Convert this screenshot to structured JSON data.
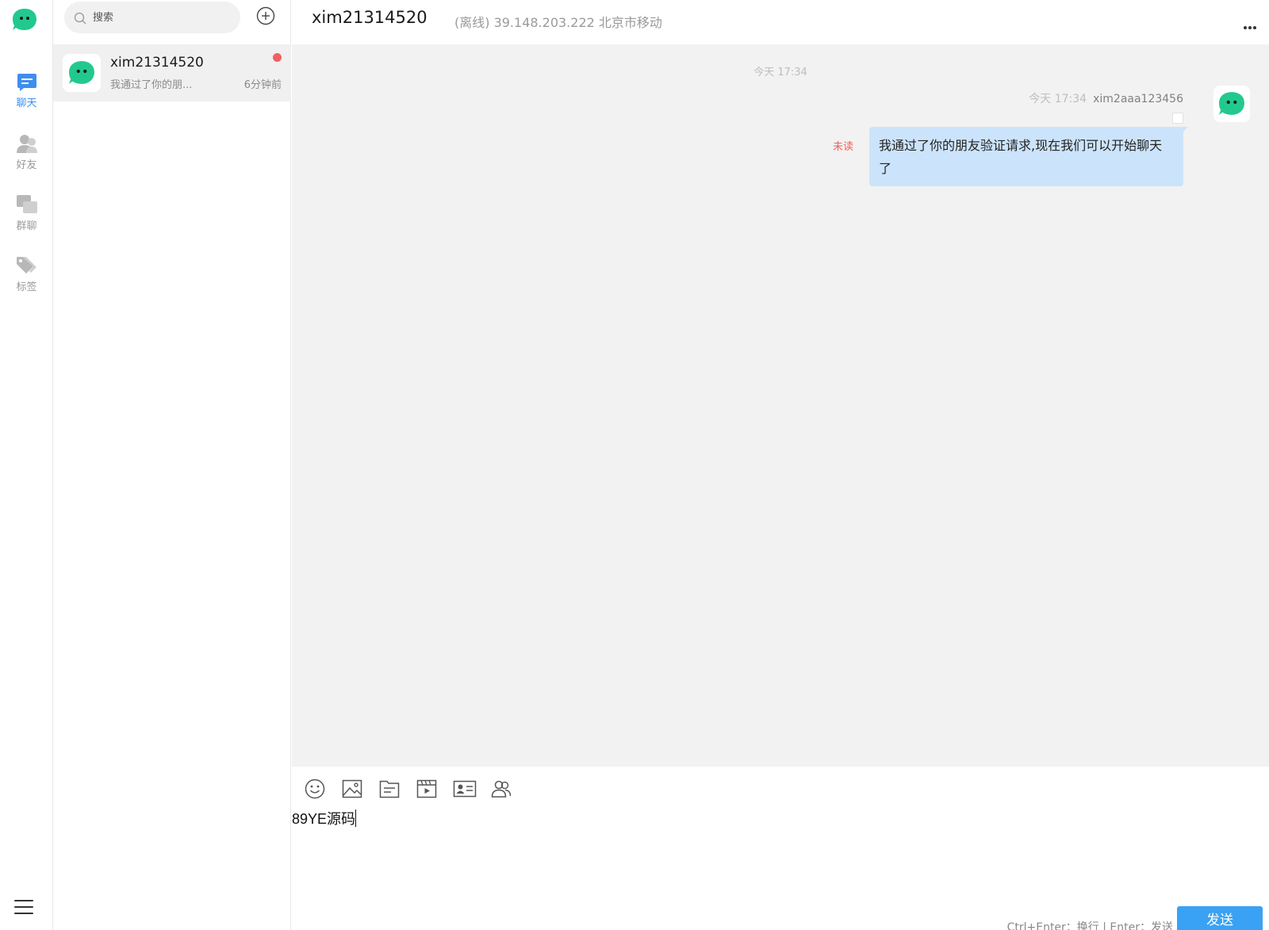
{
  "colors": {
    "brand_green": "#22c98f",
    "accent_blue": "#3d8ef0",
    "bubble_blue": "#cce4fb",
    "send_blue": "#3aa2f4",
    "unread_red": "#f26060"
  },
  "nav": {
    "logo_icon": "app-logo-icon",
    "items": [
      {
        "label": "聊天",
        "icon": "chat-icon",
        "active": true
      },
      {
        "label": "好友",
        "icon": "friends-icon",
        "active": false
      },
      {
        "label": "群聊",
        "icon": "group-chat-icon",
        "active": false
      },
      {
        "label": "标签",
        "icon": "tag-icon",
        "active": false
      }
    ],
    "menu_icon": "hamburger-menu-icon"
  },
  "conversation_list": {
    "search": {
      "placeholder": "搜索",
      "value": ""
    },
    "add_icon": "add-circle-icon",
    "items": [
      {
        "name": "xim21314520",
        "preview": "我通过了你的朋...",
        "time": "6分钟前",
        "unread": true
      }
    ]
  },
  "chat": {
    "title": "xim21314520",
    "status": "(离线) 39.148.203.222 北京市移动",
    "more_icon": "more-dots-icon",
    "day_stamp": "今天 17:34",
    "messages": [
      {
        "time": "今天 17:34",
        "sender": "xim2aaa123456",
        "read_status": "未读",
        "text": "我通过了你的朋友验证请求,现在我们可以开始聊天了",
        "outgoing": true
      }
    ]
  },
  "composer": {
    "toolbar": [
      "emoji-icon",
      "image-icon",
      "file-icon",
      "video-icon",
      "contact-card-icon",
      "group-members-icon"
    ],
    "draft": "89YE源码",
    "hint": "Ctrl+Enter：换行 | Enter：发送",
    "send_label": "发送"
  }
}
